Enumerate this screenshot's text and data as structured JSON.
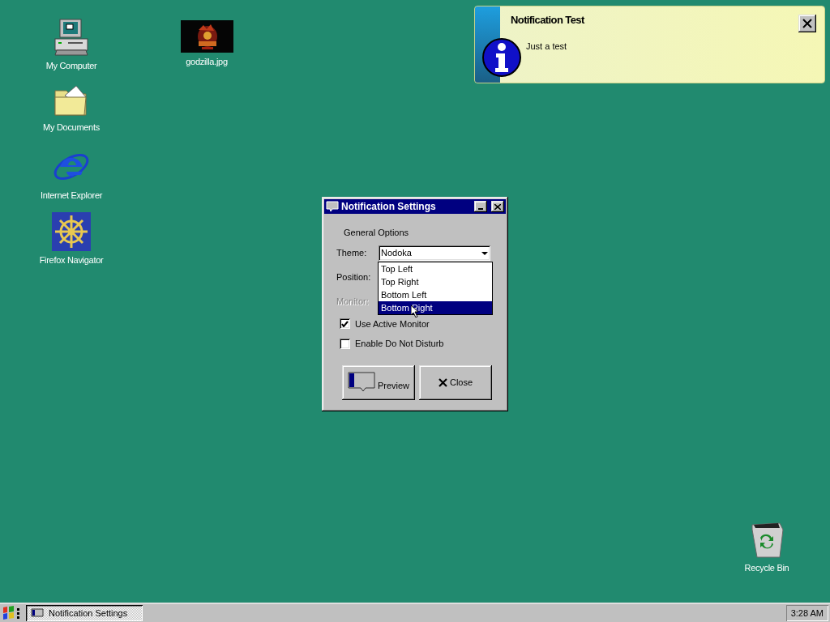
{
  "desktop_icons": [
    {
      "label": "My Computer",
      "kind": "computer"
    },
    {
      "label": "godzilla.jpg"
    },
    {
      "label": "My Documents",
      "kind": "folder"
    },
    {
      "label": "Internet Explorer",
      "kind": "browser"
    },
    {
      "label": "Firefox Navigator",
      "kind": "wheel"
    },
    {
      "label": "Recycle Bin",
      "kind": "bin"
    }
  ],
  "notification": {
    "title": "Notification Test",
    "message": "Just a test"
  },
  "dialog": {
    "title": "Notification Settings",
    "group_label": "General Options",
    "fields": [
      {
        "label": "Theme:",
        "value": "Nodoka",
        "disabled": false
      },
      {
        "label": "Position:",
        "disabled": false
      },
      {
        "label": "Monitor:",
        "disabled": true
      }
    ],
    "dropdown": {
      "options": [
        {
          "label": "Top Left",
          "selected": false
        },
        {
          "label": "Top Right",
          "selected": false
        },
        {
          "label": "Bottom Left",
          "selected": false
        },
        {
          "label": "Bottom Right",
          "selected": true
        }
      ]
    },
    "checkboxes": [
      {
        "label": "Use Active Monitor",
        "checked": true
      },
      {
        "label": "Enable Do Not Disturb",
        "checked": false
      }
    ],
    "buttons": [
      {
        "label": "Preview",
        "kind": "preview"
      },
      {
        "label": "Close",
        "kind": "close"
      }
    ]
  },
  "taskbar": {
    "tasks": [
      {
        "label": "Notification Settings",
        "selected": true
      }
    ],
    "clock": "3:28 AM"
  }
}
